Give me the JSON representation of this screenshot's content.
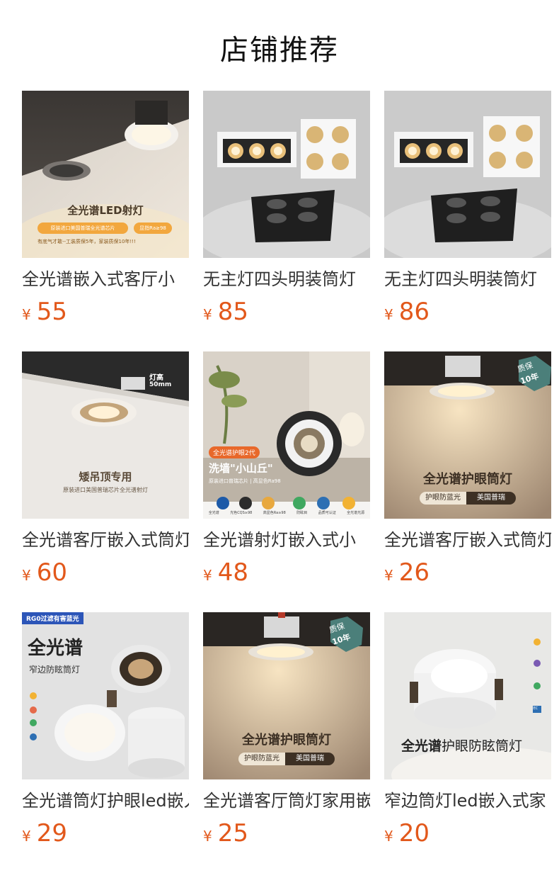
{
  "header": {
    "title": "店铺推荐"
  },
  "currency": "¥",
  "products": [
    {
      "name": "全光谱嵌入式客厅小",
      "price": "55",
      "img": {
        "headline": "全光谱LED射灯",
        "tag1": "原装进口美国普瑞全光谱芯片",
        "tag2": "显指Ra≥98",
        "note": "有底气才敢--工装质保5年，家装质保10年!!!"
      }
    },
    {
      "name": "无主灯四头明装筒灯",
      "price": "85",
      "img": {}
    },
    {
      "name": "无主灯四头明装筒灯",
      "price": "86",
      "img": {}
    },
    {
      "name": "全光谱客厅嵌入式筒灯",
      "price": "60",
      "img": {
        "headline": "矮吊顶专用",
        "sub": "原装进口美国普瑞芯片全光谱射灯",
        "spec_title": "灯高",
        "spec_value": "50mm"
      }
    },
    {
      "name": "全光谱射灯嵌入式小",
      "price": "48",
      "img": {
        "badge": "全光谱护眼2代",
        "headline": "洗墙\"小山丘\"",
        "sub": "原装进口普瑞芯片 | 高显色Ra98",
        "icons": [
          "全光谱",
          "光色CQS≥98",
          "高显色Ra≥98",
          "防眩目",
          "品质可认证",
          "全光谱光源"
        ]
      }
    },
    {
      "name": "全光谱客厅嵌入式筒灯",
      "price": "26",
      "img": {
        "headline": "全光谱护眼筒灯",
        "tag1": "护眼防蓝光",
        "tag2": "美国普瑞",
        "seal_top": "质保",
        "seal_bottom": "10年"
      }
    },
    {
      "name": "全光谱筒灯护眼led嵌入式",
      "price": "29",
      "img": {
        "banner": "RG0过滤有害蓝光",
        "headline": "全光谱",
        "sub": "窄边防眩筒灯"
      }
    },
    {
      "name": "全光谱客厅筒灯家用嵌入式",
      "price": "25",
      "img": {
        "headline": "全光谱护眼筒灯",
        "tag1": "护眼防蓝光",
        "tag2": "美国普瑞",
        "seal_top": "质保",
        "seal_bottom": "10年"
      }
    },
    {
      "name": "窄边筒灯led嵌入式家",
      "price": "20",
      "img": {
        "headline_bold": "全光谱",
        "headline_rest": "护眼防眩筒灯",
        "icon_label": "IEC"
      }
    }
  ]
}
